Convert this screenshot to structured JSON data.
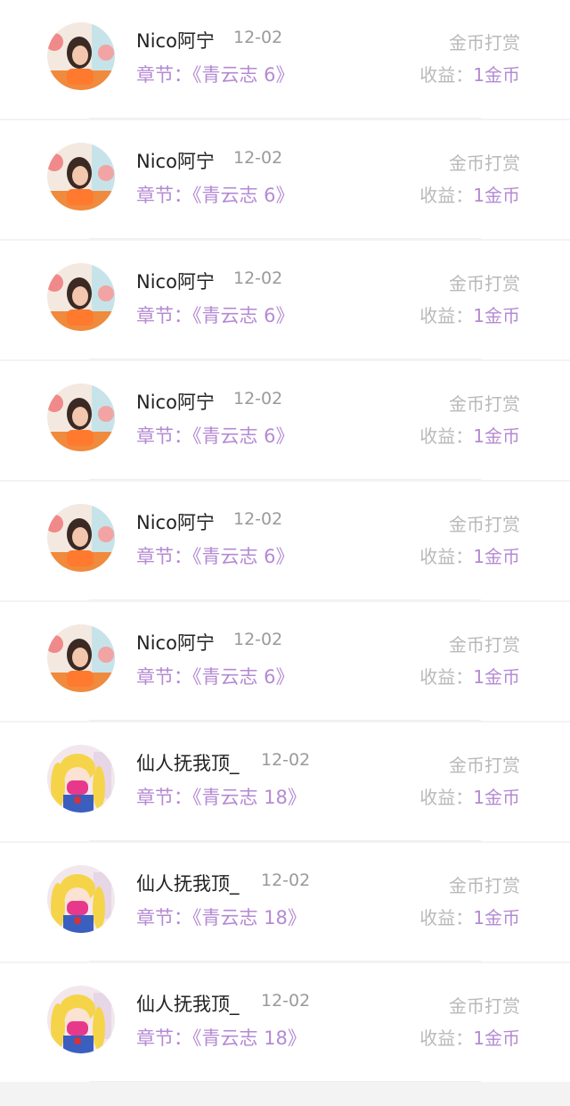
{
  "rows": [
    {
      "avatar": "woman-photo-avatar",
      "name": "Nico阿宁",
      "date": "12-02",
      "chapter_prefix": "章节：",
      "chapter": "《青云志 6》",
      "type": "金币打赏",
      "income_label": "收益：",
      "income_value": "1金币"
    },
    {
      "avatar": "woman-photo-avatar",
      "name": "Nico阿宁",
      "date": "12-02",
      "chapter_prefix": "章节：",
      "chapter": "《青云志 6》",
      "type": "金币打赏",
      "income_label": "收益：",
      "income_value": "1金币"
    },
    {
      "avatar": "woman-photo-avatar",
      "name": "Nico阿宁",
      "date": "12-02",
      "chapter_prefix": "章节：",
      "chapter": "《青云志 6》",
      "type": "金币打赏",
      "income_label": "收益：",
      "income_value": "1金币"
    },
    {
      "avatar": "woman-photo-avatar",
      "name": "Nico阿宁",
      "date": "12-02",
      "chapter_prefix": "章节：",
      "chapter": "《青云志 6》",
      "type": "金币打赏",
      "income_label": "收益：",
      "income_value": "1金币"
    },
    {
      "avatar": "woman-photo-avatar",
      "name": "Nico阿宁",
      "date": "12-02",
      "chapter_prefix": "章节：",
      "chapter": "《青云志 6》",
      "type": "金币打赏",
      "income_label": "收益：",
      "income_value": "1金币"
    },
    {
      "avatar": "woman-photo-avatar",
      "name": "Nico阿宁",
      "date": "12-02",
      "chapter_prefix": "章节：",
      "chapter": "《青云志 6》",
      "type": "金币打赏",
      "income_label": "收益：",
      "income_value": "1金币"
    },
    {
      "avatar": "anime-girl-avatar",
      "name": "仙人抚我顶_",
      "date": "12-02",
      "chapter_prefix": "章节：",
      "chapter": "《青云志 18》",
      "type": "金币打赏",
      "income_label": "收益：",
      "income_value": "1金币"
    },
    {
      "avatar": "anime-girl-avatar",
      "name": "仙人抚我顶_",
      "date": "12-02",
      "chapter_prefix": "章节：",
      "chapter": "《青云志 18》",
      "type": "金币打赏",
      "income_label": "收益：",
      "income_value": "1金币"
    },
    {
      "avatar": "anime-girl-avatar",
      "name": "仙人抚我顶_",
      "date": "12-02",
      "chapter_prefix": "章节：",
      "chapter": "《青云志 18》",
      "type": "金币打赏",
      "income_label": "收益：",
      "income_value": "1金币"
    }
  ],
  "colors": {
    "accent_purple": "#b48ad3",
    "name_text": "#222222",
    "muted_text": "#9a9a9a",
    "background": "#f3f3f4",
    "row_background": "#ffffff"
  }
}
